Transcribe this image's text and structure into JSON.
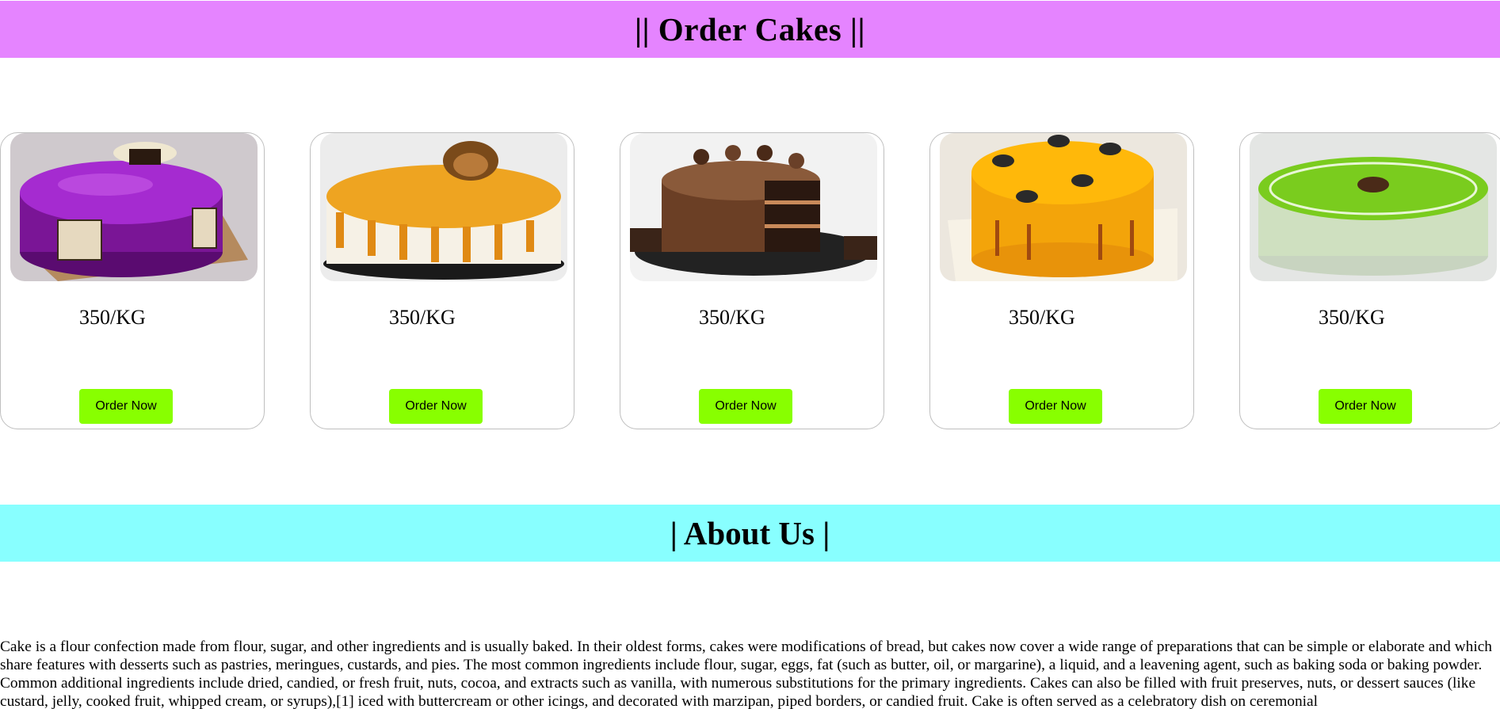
{
  "order_section": {
    "title": "|| Order Cakes ||",
    "cards": [
      {
        "image": "purple-glazed-cake",
        "price": "350/KG",
        "button_label": "Order Now"
      },
      {
        "image": "butterscotch-caramel-cake",
        "price": "350/KG",
        "button_label": "Order Now"
      },
      {
        "image": "chocolate-truffle-cake",
        "price": "350/KG",
        "button_label": "Order Now"
      },
      {
        "image": "mango-orange-cake",
        "price": "350/KG",
        "button_label": "Order Now"
      },
      {
        "image": "green-pista-cake",
        "price": "350/KG",
        "button_label": "Order Now"
      }
    ]
  },
  "about_section": {
    "title": "| About Us |",
    "text": "Cake is a flour confection made from flour, sugar, and other ingredients and is usually baked. In their oldest forms, cakes were modifications of bread, but cakes now cover a wide range of preparations that can be simple or elaborate and which share features with desserts such as pastries, meringues, custards, and pies. The most common ingredients include flour, sugar, eggs, fat (such as butter, oil, or margarine), a liquid, and a leavening agent, such as baking soda or baking powder. Common additional ingredients include dried, candied, or fresh fruit, nuts, cocoa, and extracts such as vanilla, with numerous substitutions for the primary ingredients. Cakes can also be filled with fruit preserves, nuts, or dessert sauces (like custard, jelly, cooked fruit, whipped cream, or syrups),[1] iced with buttercream or other icings, and decorated with marzipan, piped borders, or candied fruit. Cake is often served as a celebratory dish on ceremonial"
  },
  "colors": {
    "order_header_bg": "#e584ff",
    "about_header_bg": "#88ffff",
    "button_bg": "#88ff00"
  }
}
